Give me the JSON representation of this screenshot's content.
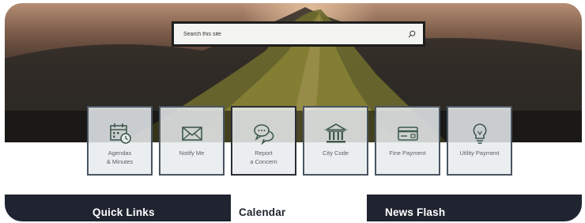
{
  "search": {
    "placeholder": "Search this site"
  },
  "tiles": [
    {
      "icon": "calendar-clock-icon",
      "line1": "Agendas",
      "line2": "& Minutes"
    },
    {
      "icon": "envelope-icon",
      "line1": "Notify Me",
      "line2": ""
    },
    {
      "icon": "speech-bubbles-icon",
      "line1": "Report",
      "line2": "a Concern"
    },
    {
      "icon": "courthouse-icon",
      "line1": "City Code",
      "line2": ""
    },
    {
      "icon": "payment-card-icon",
      "line1": "Fine Payment",
      "line2": ""
    },
    {
      "icon": "lightbulb-icon",
      "line1": "Utility Payment",
      "line2": ""
    }
  ],
  "sections": {
    "quick_links": "Quick Links",
    "calendar": "Calendar",
    "news_flash": "News Flash"
  },
  "colors": {
    "icon": "#3f5a4d",
    "panel_dark": "#1f2430",
    "tile_bg": "#e8ebee"
  }
}
